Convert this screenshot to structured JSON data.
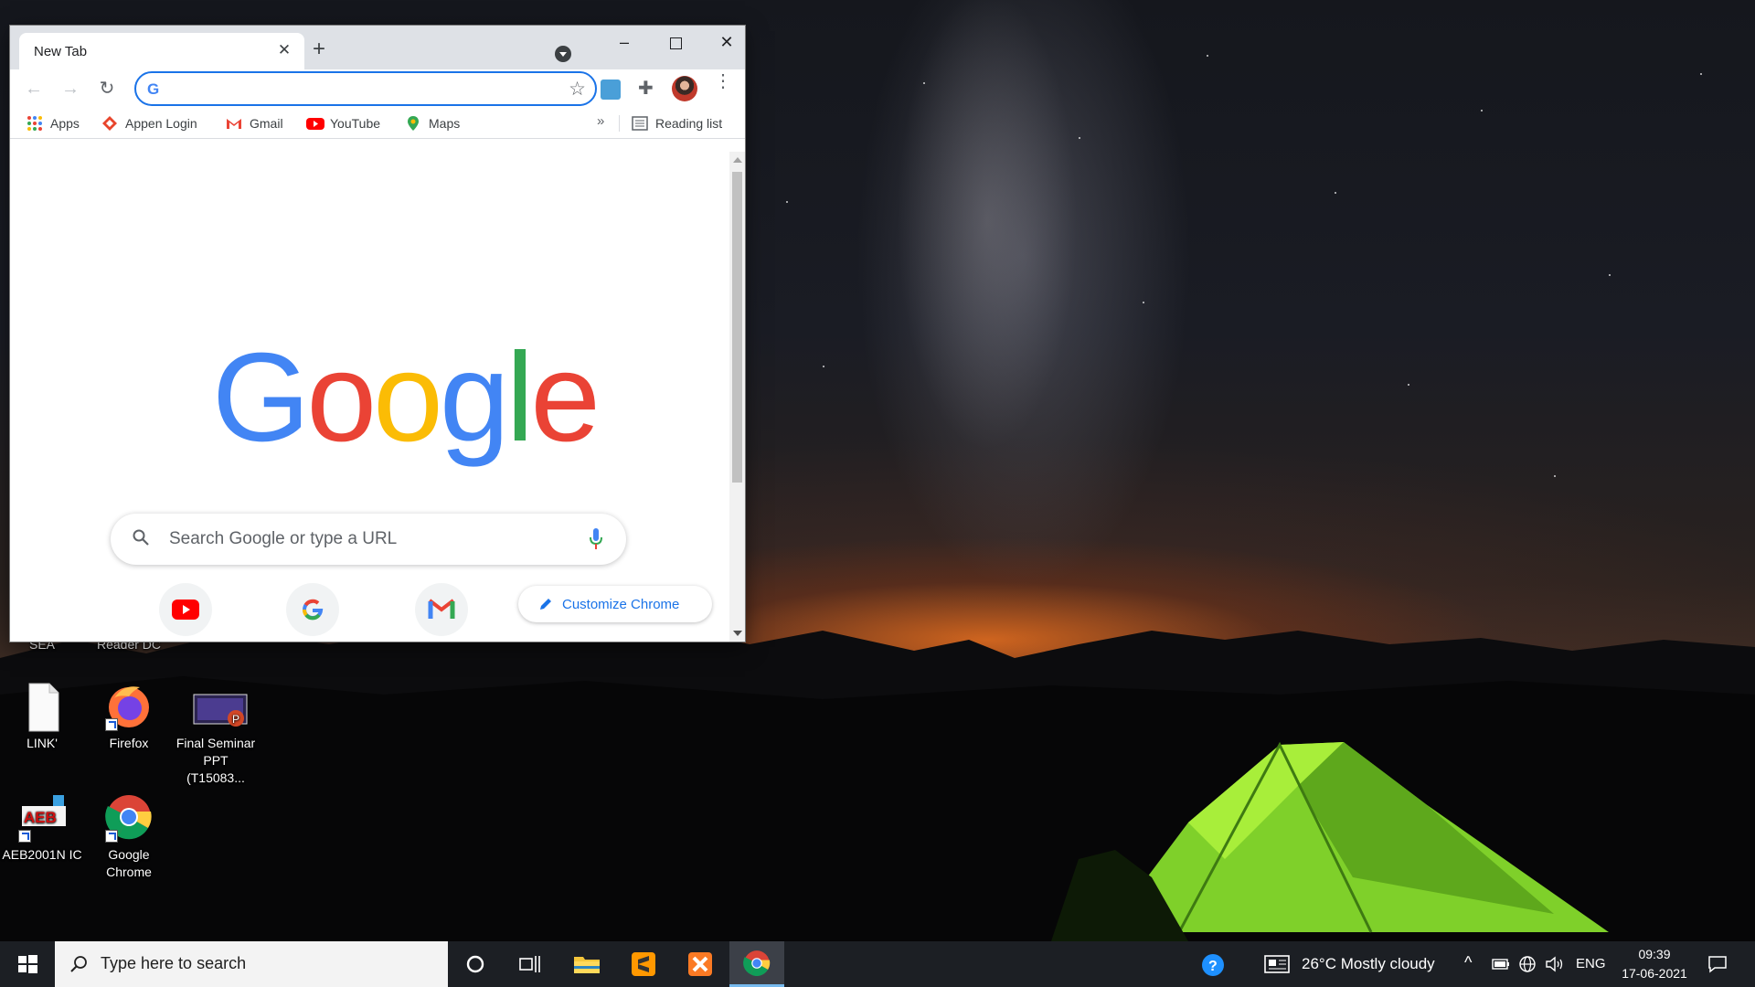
{
  "browser": {
    "tab_title": "New Tab",
    "omnibox_value": "",
    "bookmarks": [
      "Apps",
      "Appen Login",
      "Gmail",
      "YouTube",
      "Maps"
    ],
    "bookmarks_more": "»",
    "reading_list": "Reading list"
  },
  "newtab": {
    "logo_letters": [
      "G",
      "o",
      "o",
      "g",
      "l",
      "e"
    ],
    "logo_colors": [
      "#4285F4",
      "#EA4335",
      "#FBBC05",
      "#4285F4",
      "#34A853",
      "#EA4335"
    ],
    "search_placeholder": "Search Google or type a URL",
    "customize_label": "Customize Chrome"
  },
  "desktop": {
    "icons": [
      {
        "label": "SEA"
      },
      {
        "label": "Reader DC"
      },
      {
        "label": "LINK'"
      },
      {
        "label": "Firefox"
      },
      {
        "label": "Final Seminar PPT (T15083..."
      },
      {
        "label": "AEB2001N IC"
      },
      {
        "label": "Google Chrome"
      }
    ]
  },
  "taskbar": {
    "search_placeholder": "Type here to search",
    "weather": "26°C  Mostly cloudy",
    "language": "ENG",
    "time": "09:39",
    "date": "17-06-2021"
  },
  "colors": {
    "accent": "#1a73e8",
    "taskbar": "#1c1f24",
    "titlebar": "#dee1e6"
  }
}
